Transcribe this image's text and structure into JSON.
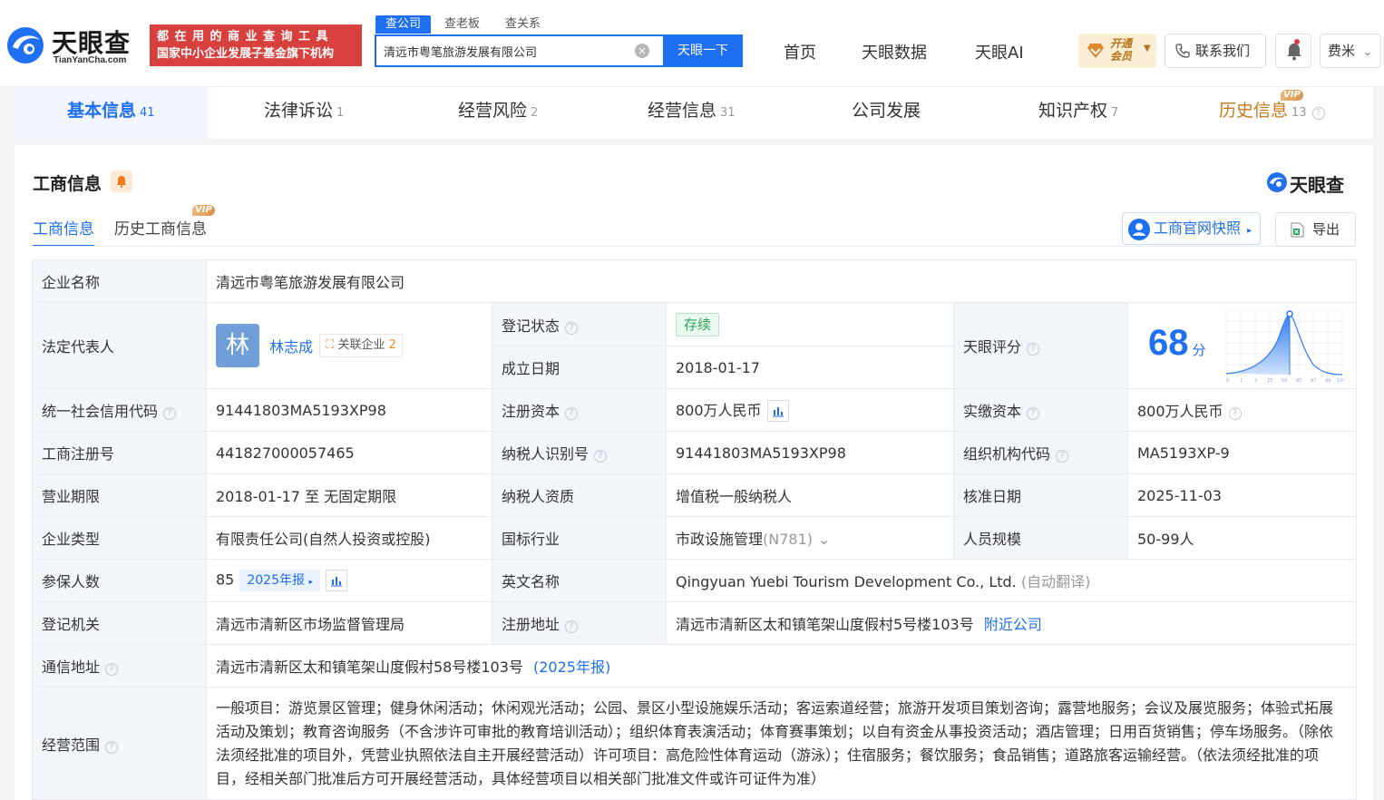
{
  "brand": {
    "name_cn": "天眼查",
    "name_en": "TianYanCha.com",
    "slogan_line1": "都在用的商业查询工具",
    "slogan_line2": "国家中小企业发展子基金旗下机构"
  },
  "search": {
    "tabs": [
      "查公司",
      "查老板",
      "查关系"
    ],
    "value": "清远市粤笔旅游发展有限公司",
    "button": "天眼一下"
  },
  "nav": {
    "items": [
      "首页",
      "天眼数据",
      "天眼AI"
    ],
    "vip_line1": "开通",
    "vip_line2": "会员",
    "contact": "联系我们",
    "user": "费米"
  },
  "main_tabs": [
    {
      "label": "基本信息",
      "count": "41"
    },
    {
      "label": "法律诉讼",
      "count": "1"
    },
    {
      "label": "经营风险",
      "count": "2"
    },
    {
      "label": "经营信息",
      "count": "31"
    },
    {
      "label": "公司发展",
      "count": ""
    },
    {
      "label": "知识产权",
      "count": "7"
    },
    {
      "label": "历史信息",
      "count": "13"
    }
  ],
  "vip_badge": "VIP",
  "section": {
    "title": "工商信息",
    "sub_tabs": [
      "工商信息",
      "历史工商信息"
    ],
    "snapshot": "工商官网快照",
    "export": "导出"
  },
  "company": {
    "name_label": "企业名称",
    "name": "清远市粤笔旅游发展有限公司",
    "legal_label": "法定代表人",
    "legal_avatar": "林",
    "legal_name": "林志成",
    "related_label": "关联企业",
    "related_count": "2",
    "status_label": "登记状态",
    "status": "存续",
    "founded_label": "成立日期",
    "founded": "2018-01-17",
    "rating_label": "天眼评分",
    "score": "68",
    "score_unit": "分",
    "score_axis": [
      "0",
      "1",
      "3",
      "15",
      "50",
      "85",
      "97",
      "99",
      "100"
    ],
    "credit_label": "统一社会信用代码",
    "credit": "91441803MA5193XP98",
    "capital_label": "注册资本",
    "capital": "800万人民币",
    "paid_label": "实缴资本",
    "paid": "800万人民币",
    "regno_label": "工商注册号",
    "regno": "441827000057465",
    "taxid_label": "纳税人识别号",
    "taxid": "91441803MA5193XP98",
    "orgcode_label": "组织机构代码",
    "orgcode": "MA5193XP-9",
    "term_label": "营业期限",
    "term": "2018-01-17 至 无固定期限",
    "taxtype_label": "纳税人资质",
    "taxtype": "增值税一般纳税人",
    "approve_label": "核准日期",
    "approve": "2025-11-03",
    "type_label": "企业类型",
    "type": "有限责任公司(自然人投资或控股)",
    "industry_label": "国标行业",
    "industry": "市政设施管理",
    "industry_code": "(N781)",
    "staff_label": "人员规模",
    "staff": "50-99人",
    "insured_label": "参保人数",
    "insured": "85",
    "insured_report": "2025年报",
    "en_label": "英文名称",
    "en_name": "Qingyuan Yuebi Tourism Development Co., Ltd.",
    "en_note": "(自动翻译)",
    "authority_label": "登记机关",
    "authority": "清远市清新区市场监督管理局",
    "addr_label": "注册地址",
    "addr": "清远市清新区太和镇笔架山度假村5号楼103号",
    "addr_link": "附近公司",
    "mail_label": "通信地址",
    "mail": "清远市清新区太和镇笔架山度假村58号楼103号",
    "mail_note": "(2025年报)",
    "scope_label": "经营范围",
    "scope": "一般项目：游览景区管理；健身休闲活动；休闲观光活动；公园、景区小型设施娱乐活动；客运索道经营；旅游开发项目策划咨询；露营地服务；会议及展览服务；体验式拓展活动及策划；教育咨询服务（不含涉许可审批的教育培训活动）；组织体育表演活动；体育赛事策划；以自有资金从事投资活动；酒店管理；日用百货销售；停车场服务。（除依法须经批准的项目外，凭营业执照依法自主开展经营活动）许可项目：高危险性体育运动（游泳）；住宿服务；餐饮服务；食品销售；道路旅客运输经营。（依法须经批准的项目，经相关部门批准后方可开展经营活动，具体经营项目以相关部门批准文件或许可证件为准）"
  },
  "colors": {
    "accent": "#1f6ff2",
    "brand_red": "#d8403e",
    "status_green": "#26a55a",
    "vip_gold": "#b67418"
  }
}
